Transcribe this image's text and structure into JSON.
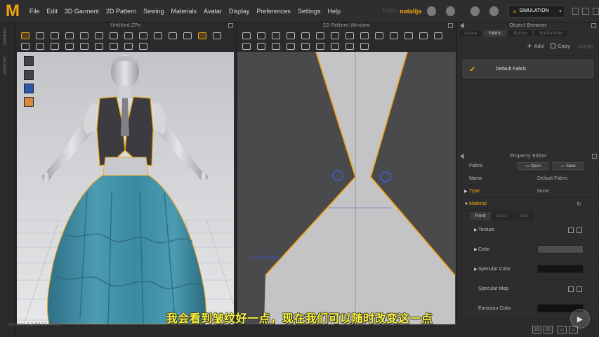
{
  "app": {
    "logo": "M",
    "menu": [
      "File",
      "Edit",
      "3D Garment",
      "2D Pattern",
      "Sewing",
      "Materials",
      "Avatar",
      "Display",
      "Preferences",
      "Settings",
      "Help"
    ],
    "user_label": "Hello",
    "user_name": "natalija",
    "mode": "SIMULATION"
  },
  "left_strip": {
    "tabs": [
      "LIBRARY",
      "HISTORY"
    ]
  },
  "window_3d": {
    "title": "Untitled.ZPrj",
    "version_text": "Version: 4.2.90 (r14775)"
  },
  "window_2d": {
    "title": "2D Pattern Window",
    "pattern_label": "Default Fabric"
  },
  "object_browser": {
    "title": "Object Browser",
    "tabs": [
      "Scene",
      "Fabric",
      "Button",
      "Buttonhole"
    ],
    "active_tab": "Fabric",
    "add_label": "Add",
    "copy_label": "Copy",
    "assign_label": "Assign",
    "fabric_item": "Default Fabric"
  },
  "property_editor": {
    "title": "Property Editor",
    "section_label": "Fabric",
    "open_label": "Open",
    "save_label": "Save",
    "name_label": "Name",
    "name_value": "Default Fabric",
    "type_label": "Type",
    "type_value": "None",
    "material_label": "Material",
    "tabs": [
      "Front",
      "Back",
      "Side"
    ],
    "texture_label": "Texture",
    "color_label": "Color",
    "specular_color_label": "Specular Color",
    "specular_map_label": "Specular Map",
    "emission_color_label": "Emission Color",
    "colors": {
      "color_swatch": "#4d4d50",
      "specular_swatch": "#141414",
      "emission_swatch": "#111111"
    }
  },
  "subtitle": "我会看到皱纹好一点，现在我们可以随时改变这一点",
  "colors": {
    "accent": "#f0a30a",
    "dress": "#3f8aa0",
    "vest": "#3b3c3f",
    "pattern_fill": "#c4c4c6",
    "pattern_bg": "#4a4a4d",
    "subtitle": "#f7f13a"
  }
}
